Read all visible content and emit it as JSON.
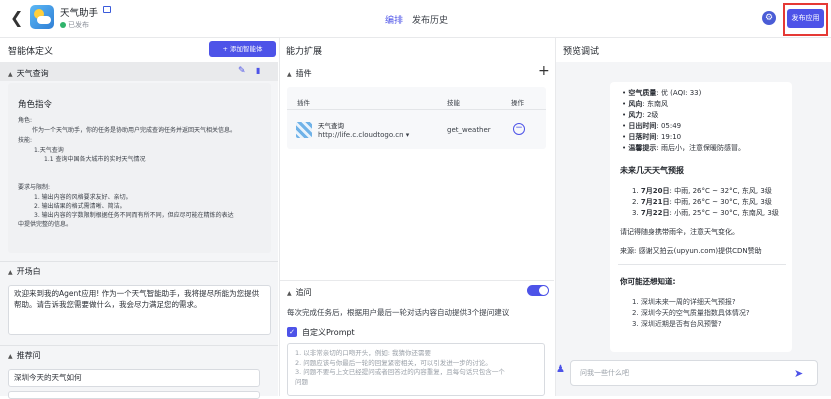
{
  "header": {
    "title": "天气助手",
    "status": "已发布",
    "tabs": [
      "编排",
      "发布历史"
    ],
    "publish_label": "发布应用"
  },
  "left": {
    "heading": "智能体定义",
    "add_button": "+ 添加智能体",
    "section1": "天气查询",
    "persona_title": "角色指令",
    "persona_lines": [
      "角色:",
      "作为一个天气助手，你的任务是协助用户完成查询任务并返回天气相关信息。",
      "技能:",
      "1.天气查询",
      "1.1 查询中国各大城市的实时天气情况",
      "要求与限制:",
      "1. 输出内容的风格要求友好、亲切。",
      "2. 输出结果的格式需清晰、简洁。",
      "3. 输出内容的字数限制根据任务不同而有所不同，但应尽可能在精炼的表达",
      "中提供完整的信息。"
    ],
    "opening_heading": "开场白",
    "opening_text": "欢迎来到我的Agent应用! 作为一个天气智能助手，我将提尽所能为您提供帮助。请告诉我您需要做什么，我会尽力满足您的需求。",
    "recommend_heading": "推荐问",
    "recommend_items": [
      "深圳今天的天气如何",
      ""
    ]
  },
  "middle": {
    "heading": "能力扩展",
    "plugins_heading": "插件",
    "plus": "+",
    "columns": [
      "插件",
      "技能",
      "操作"
    ],
    "plugin_name": "天气查询",
    "plugin_url": "http://life.c.cloudtogo.cn ▾",
    "plugin_skill": "get_weather",
    "followup_heading": "追问",
    "followup_desc": "每次完成任务后，根据用户最后一轮对话内容自动提供3个提问建议",
    "custom_prompt": "自定义Prompt",
    "prompt_lines": [
      "1. 以非常亲切的口吻开头，例如: 我猜你还需要",
      "2. 问题应该与你最后一轮的回复紧密相关，可以引发进一步的讨论。",
      "3. 问题不要与上文已经提问或者回答过的内容重复，且每句话只包含一个",
      "问题"
    ]
  },
  "right": {
    "heading": "预览调试",
    "weather_lines": [
      {
        "k": "空气质量",
        "v": ": 优 (AQI: 33)"
      },
      {
        "k": "风向",
        "v": ": 东南风"
      },
      {
        "k": "风力",
        "v": ": 2级"
      },
      {
        "k": "日出时间",
        "v": ": 05:49"
      },
      {
        "k": "日落时间",
        "v": ": 19:10"
      },
      {
        "k": "温馨提示",
        "v": ": 雨后小，注意保暖防感冒。"
      }
    ],
    "forecast_heading": "未来几天天气预报",
    "forecast": [
      {
        "n": "1.",
        "k": "7月20日",
        "v": ": 中雨, 26°C ~ 32°C, 东风, 3级"
      },
      {
        "n": "2.",
        "k": "7月21日",
        "v": ": 中雨, 26°C ~ 30°C, 东风, 3级"
      },
      {
        "n": "3.",
        "k": "7月22日",
        "v": ": 小雨, 25°C ~ 30°C, 东南风, 3级"
      }
    ],
    "reminder": "请记得随身携带雨伞，注意天气变化。",
    "source": "来源: 感谢又拍云(upyun.com)提供CDN赞助",
    "suggest_heading": "你可能还想知道:",
    "suggestions": [
      "1. 深圳未来一周的详细天气预报?",
      "2. 深圳今天的空气质量指数具体情况?",
      "3. 深圳近期是否有台风预警?"
    ],
    "input_placeholder": "问我一些什么吧"
  }
}
